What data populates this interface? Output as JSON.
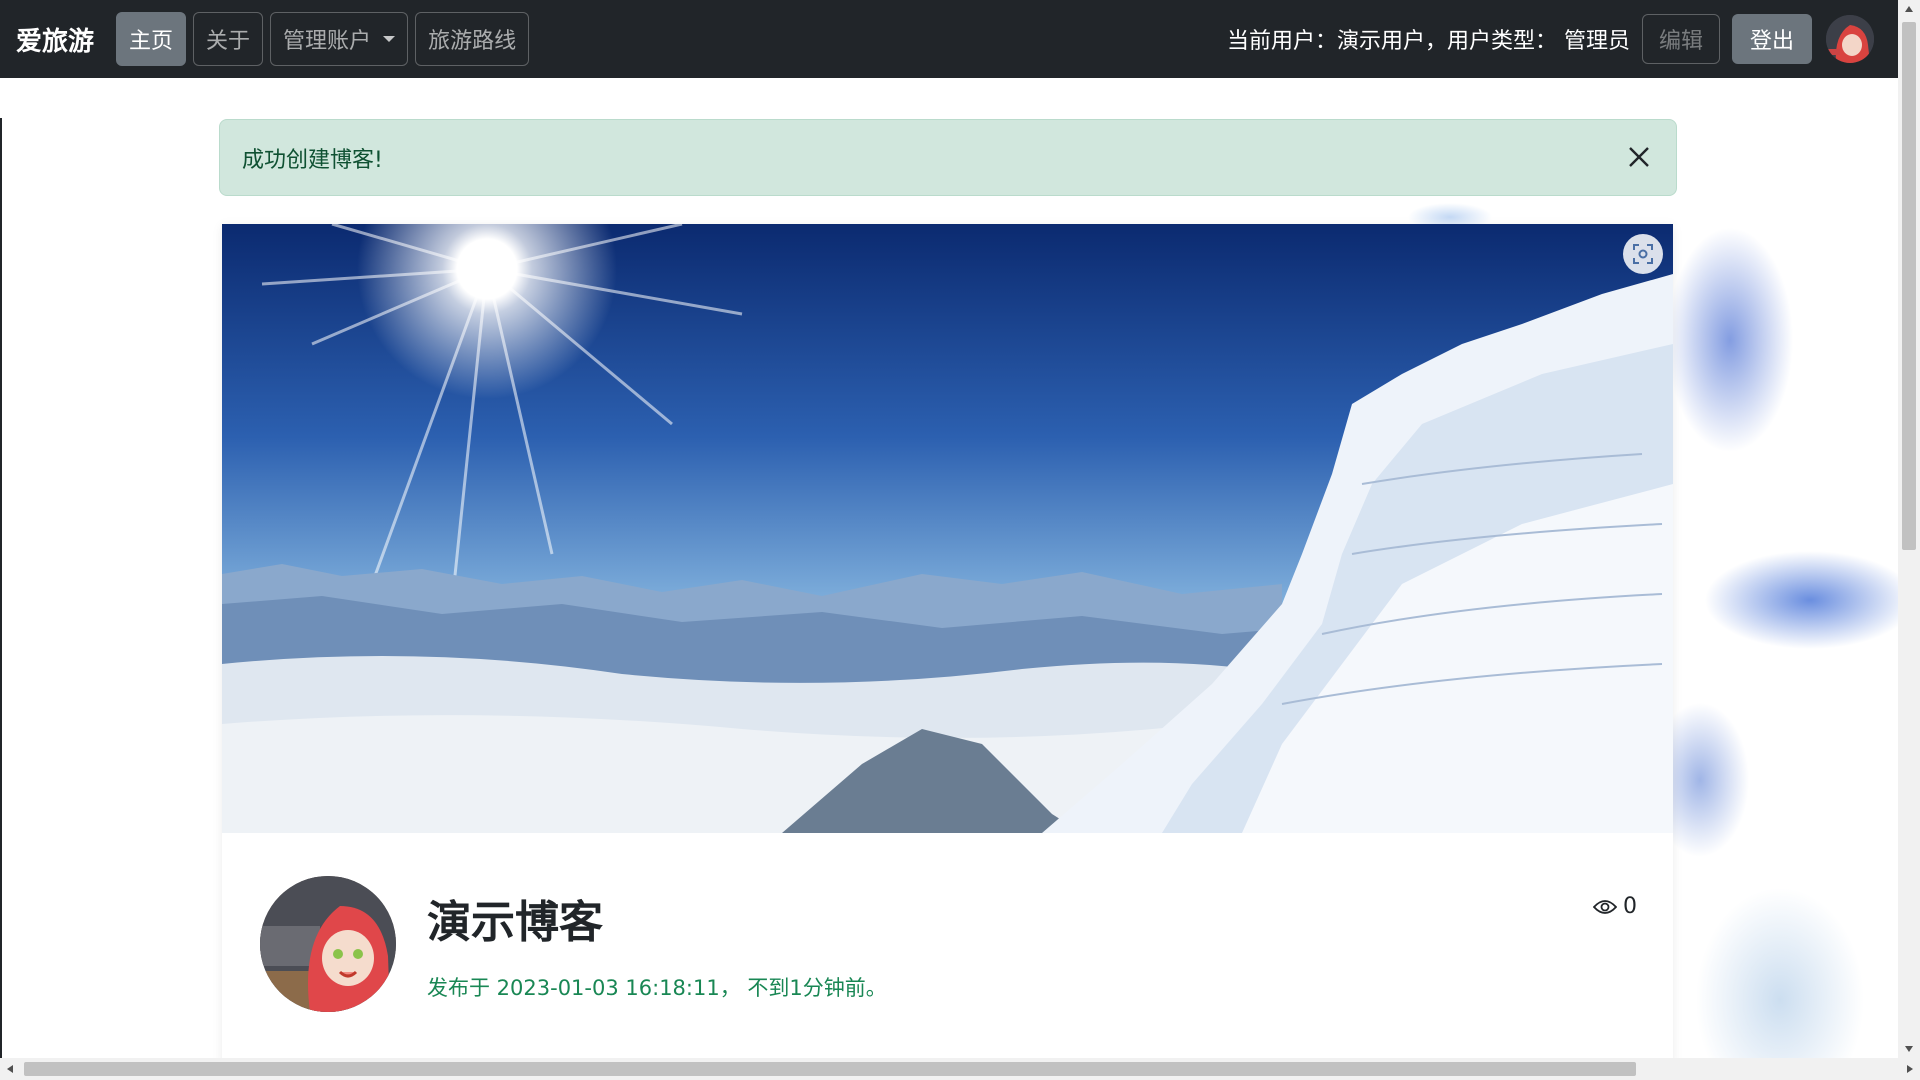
{
  "navbar": {
    "brand": "爱旅游",
    "items": [
      {
        "label": "主页",
        "active": true
      },
      {
        "label": "关于",
        "active": false
      },
      {
        "label": "管理账户",
        "active": false,
        "dropdown": true
      },
      {
        "label": "旅游路线",
        "active": false
      }
    ],
    "current_user_text": "当前用户：演示用户，用户类型：  管理员",
    "edit_label": "编辑",
    "logout_label": "登出"
  },
  "alert": {
    "message": "成功创建博客!"
  },
  "blog": {
    "title": "演示博客",
    "meta": "发布于 2023-01-03 16:18:11，  不到1分钟前。",
    "views": "0"
  },
  "colors": {
    "navbar_bg": "#212529",
    "active_nav": "#6c757d",
    "alert_bg": "#d1e7dd",
    "alert_text": "#0f5132",
    "meta_text": "#198754"
  },
  "icons": [
    "close-icon",
    "screenshot-icon",
    "eye-icon",
    "chevron-down-icon",
    "scroll-arrow-icon"
  ]
}
